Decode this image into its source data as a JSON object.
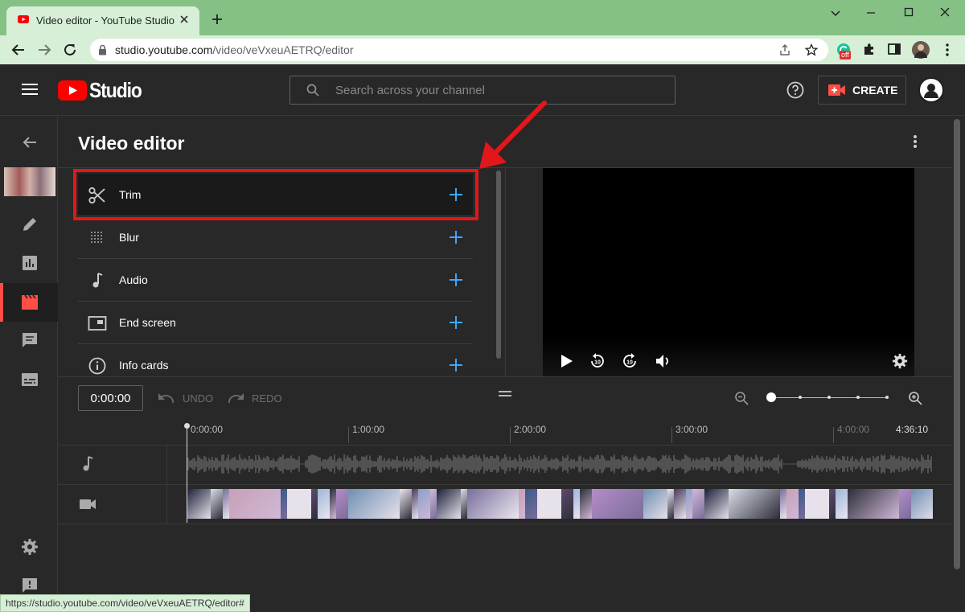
{
  "browser": {
    "tab_title": "Video editor - YouTube Studio",
    "url_host": "studio.youtube.com",
    "url_path": "/video/veVxeuAETRQ/editor",
    "status_url": "https://studio.youtube.com/video/veVxeuAETRQ/editor#",
    "extension_badge": "off"
  },
  "header": {
    "logo_text": "Studio",
    "search_placeholder": "Search across your channel",
    "create_label": "CREATE"
  },
  "page": {
    "title": "Video editor"
  },
  "tools": [
    {
      "label": "Trim",
      "icon": "scissors-icon"
    },
    {
      "label": "Blur",
      "icon": "blur-icon"
    },
    {
      "label": "Audio",
      "icon": "music-note-icon"
    },
    {
      "label": "End screen",
      "icon": "end-screen-icon"
    },
    {
      "label": "Info cards",
      "icon": "info-icon"
    }
  ],
  "timeline": {
    "current_time": "0:00:00",
    "undo_label": "UNDO",
    "redo_label": "REDO",
    "ruler_labels": [
      "0:00:00",
      "1:00:00",
      "2:00:00",
      "3:00:00",
      "4:00:00"
    ],
    "duration": "4:36:10"
  },
  "colors": {
    "accent_red": "#ff0000",
    "highlight_red": "#e3161a",
    "plus_blue": "#3ea6ff",
    "background": "#282828"
  }
}
